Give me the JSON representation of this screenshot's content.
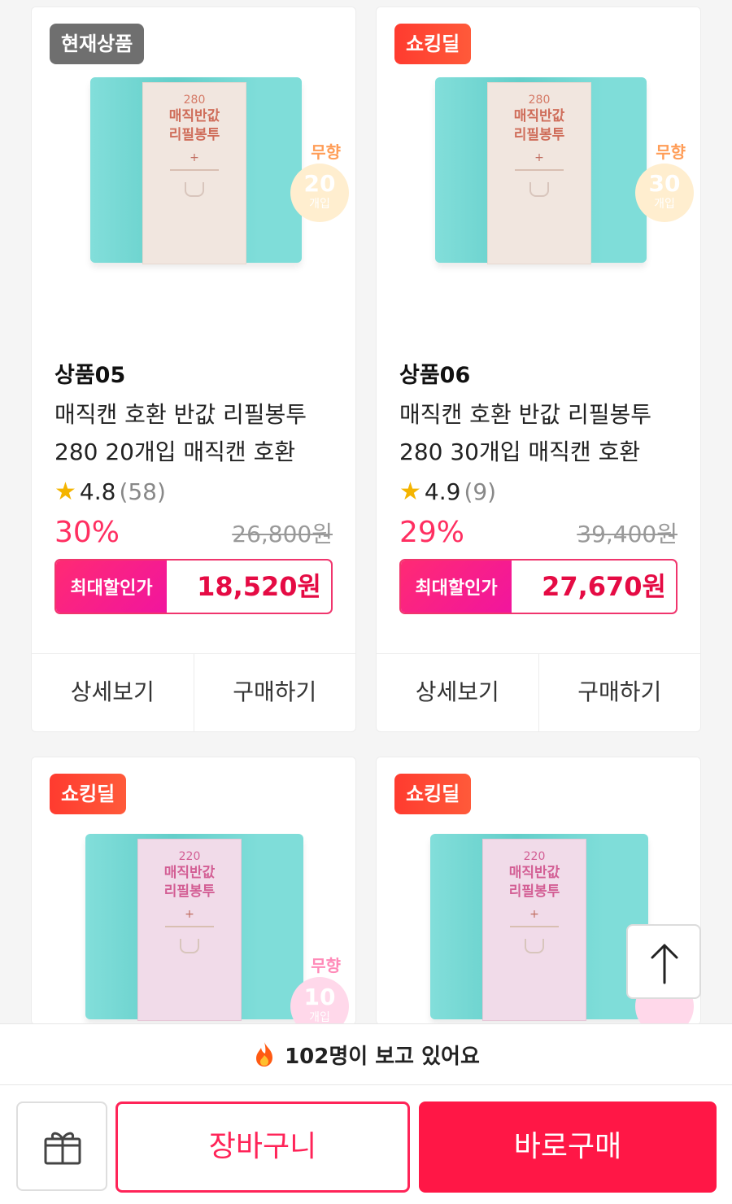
{
  "products": [
    {
      "badge": "현재상품",
      "code": "상품05",
      "title_line1": "매직캔 호환 반값 리필봉투",
      "title_line2": "280 20개입 매직캔 호환",
      "rating": "4.8",
      "reviews": "(58)",
      "discount": "30%",
      "original_price": "26,800원",
      "best_label": "최대할인가",
      "best_price": "18,520원",
      "detail_btn": "상세보기",
      "buy_btn": "구매하기",
      "package": {
        "size": "280",
        "name1": "매직반값",
        "name2": "리필봉투",
        "scent": "무향",
        "count": "20",
        "unit": "개입"
      }
    },
    {
      "badge": "쇼킹딜",
      "code": "상품06",
      "title_line1": "매직캔 호환 반값 리필봉투",
      "title_line2": "280 30개입 매직캔 호환",
      "rating": "4.9",
      "reviews": "(9)",
      "discount": "29%",
      "original_price": "39,400원",
      "best_label": "최대할인가",
      "best_price": "27,670원",
      "detail_btn": "상세보기",
      "buy_btn": "구매하기",
      "package": {
        "size": "280",
        "name1": "매직반값",
        "name2": "리필봉투",
        "scent": "무향",
        "count": "30",
        "unit": "개입"
      }
    },
    {
      "badge": "쇼킹딜",
      "package": {
        "size": "220",
        "name1": "매직반값",
        "name2": "리필봉투",
        "scent": "무향",
        "count": "10",
        "unit": "개입"
      }
    },
    {
      "badge": "쇼킹딜",
      "package": {
        "size": "220",
        "name1": "매직반값",
        "name2": "리필봉투"
      }
    }
  ],
  "viewers_text": "102명이 보고 있어요",
  "bottom_bar": {
    "cart": "장바구니",
    "buy_now": "바로구매"
  },
  "icons": {
    "fire": "fire-icon",
    "gift": "gift-icon",
    "scroll_top": "arrow-up-icon",
    "star": "star-icon"
  },
  "colors": {
    "accent": "#ff1746",
    "discount": "#ff2f61",
    "deal_badge": "#ff3b2f",
    "current_badge": "#6f6f6f",
    "package": "#67d7d2"
  }
}
